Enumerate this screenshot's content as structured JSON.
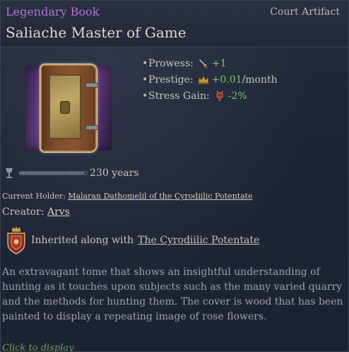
{
  "artifact": {
    "rarity": "Legendary Book",
    "category": "Court Artifact",
    "title": "Saliache Master of Game"
  },
  "stats": [
    {
      "label": "Prowess:",
      "value": "+1",
      "suffix": "",
      "icon": "prowess-dagger-icon"
    },
    {
      "label": "Prestige:",
      "value": "+0.01",
      "suffix": "/month",
      "icon": "prestige-crown-icon"
    },
    {
      "label": "Stress Gain:",
      "value": "-2%",
      "suffix": "",
      "icon": "stress-icon"
    }
  ],
  "durability": {
    "icon": "goblet-icon",
    "fill_fraction": 0.96,
    "text": "230 years"
  },
  "holder": {
    "prefix": "Current Holder:",
    "name": "Malaran Dathomelil of the Cyrodiilic Potentate"
  },
  "creator": {
    "prefix": "Creator:",
    "name": "Arvs"
  },
  "inherited": {
    "text": "Inherited along with",
    "title": "The Cyrodiilic Potentate",
    "icon": "coat-of-arms-icon"
  },
  "description": "An extravagant tome that shows an insightful understanding of hunting as it touches upon subjects such as the many varied quarry and the methods for hunting them. The cover is wood that has been painted to display a repeating image of rose flowers.",
  "click_hint": "Click to display",
  "colors": {
    "rarity": "#b473d6",
    "positive": "#7dc46a",
    "hint": "#6ea35c"
  }
}
